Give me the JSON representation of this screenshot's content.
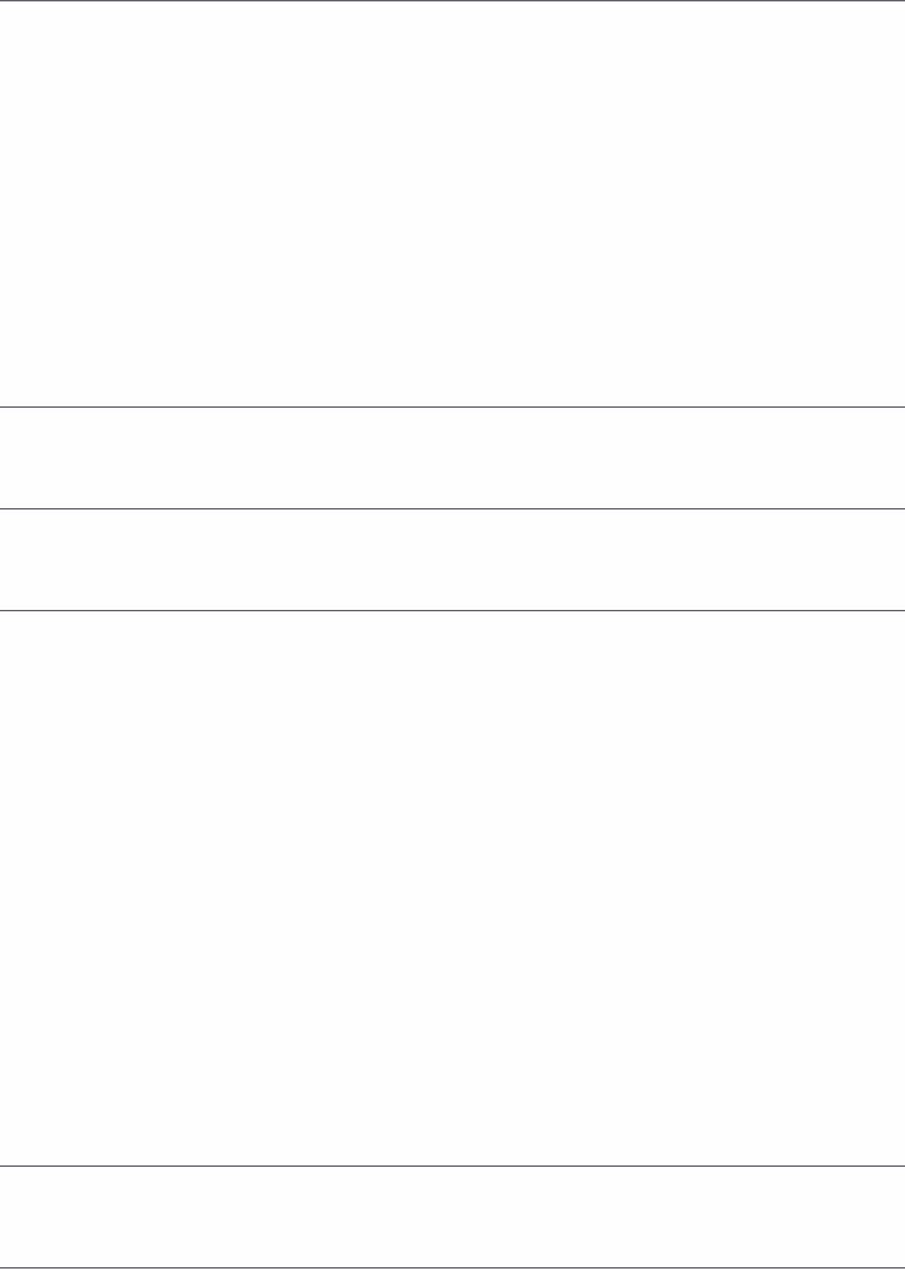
{
  "theme": {
    "background_color": "#fefefe",
    "divider_color": "#5f6068"
  }
}
